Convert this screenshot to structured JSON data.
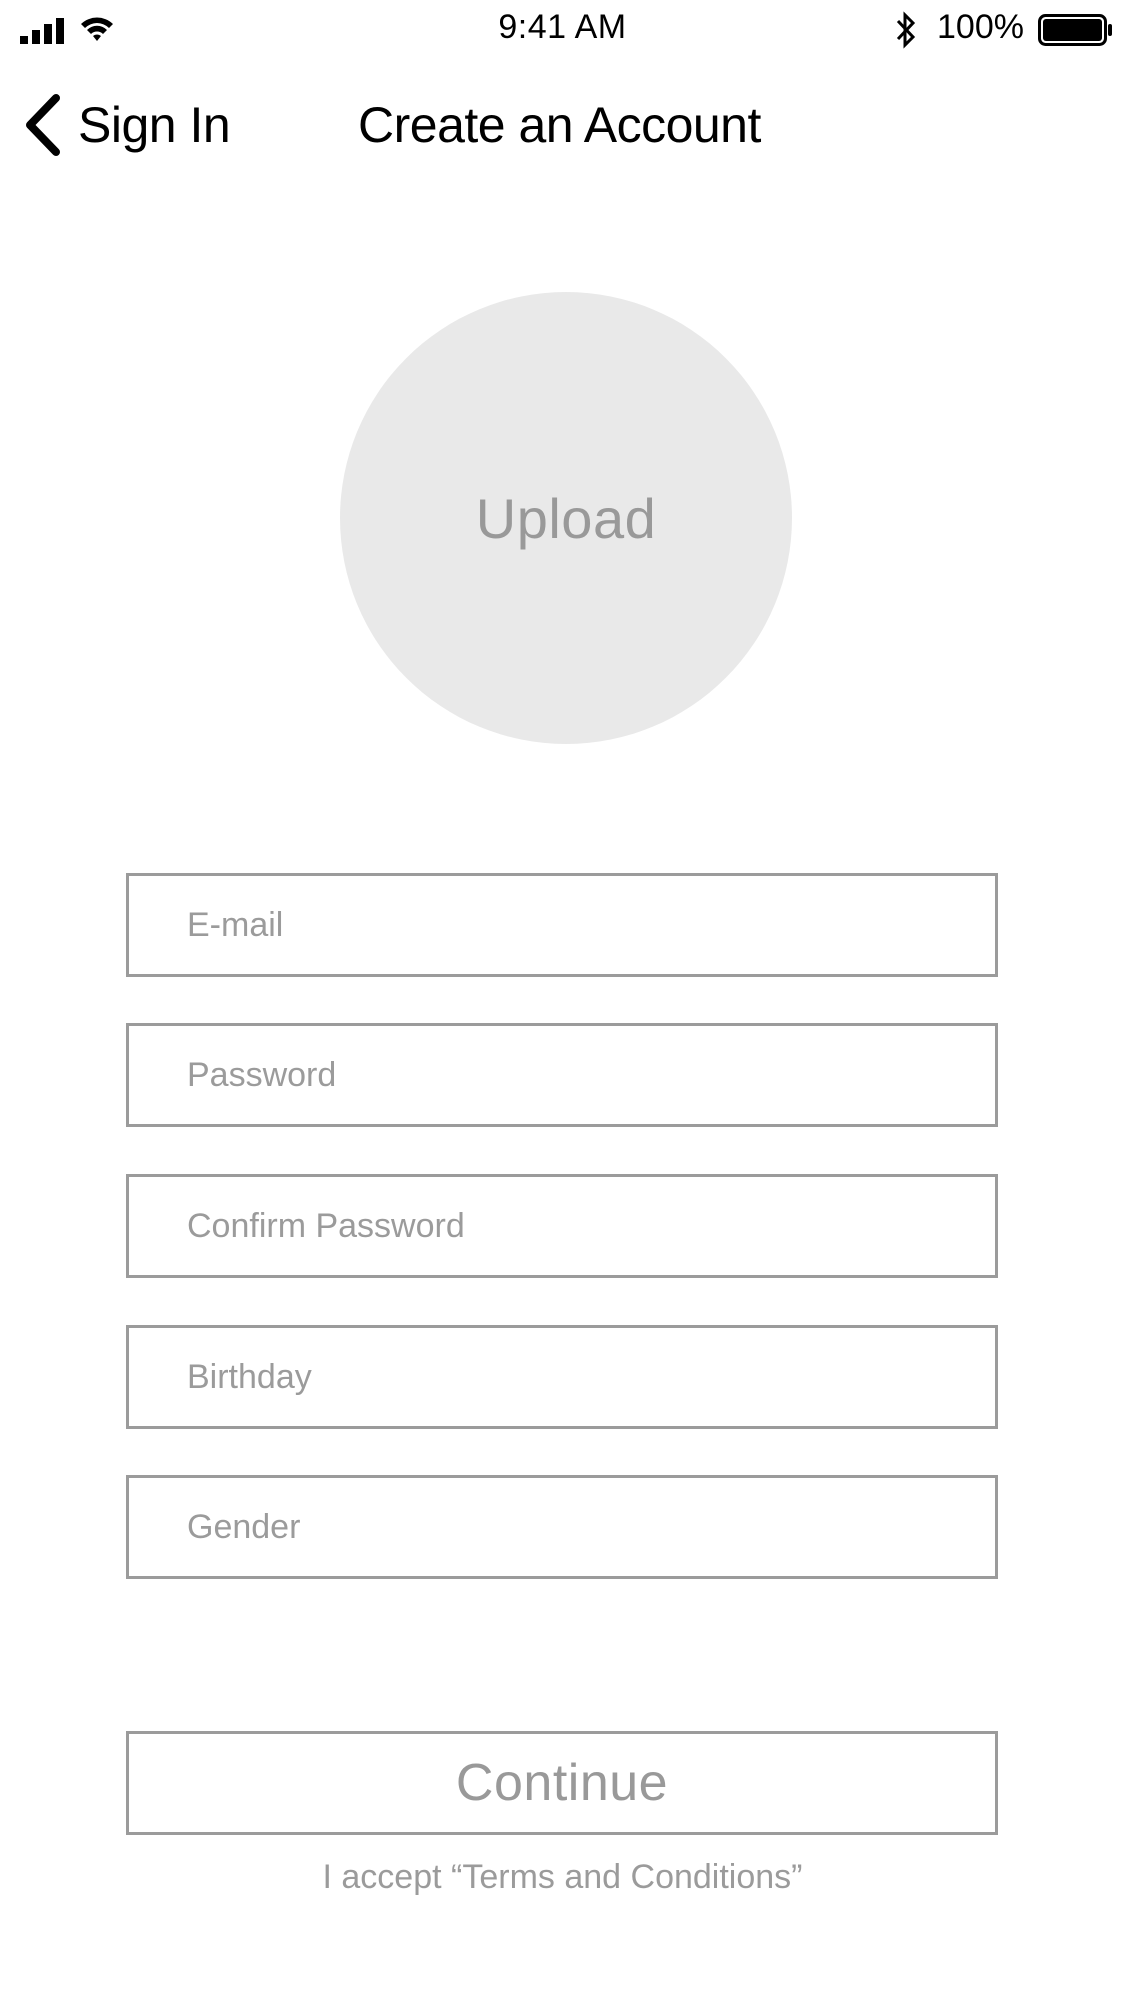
{
  "status_bar": {
    "time": "9:41 AM",
    "battery_percent": "100%",
    "icons": [
      "signal-icon",
      "wifi-icon",
      "bluetooth-icon",
      "battery-icon"
    ],
    "battery_level": 1.0
  },
  "nav": {
    "back_label": "Sign In",
    "back_icon": "chevron-left-icon",
    "title": "Create an Account"
  },
  "avatar": {
    "upload_label": "Upload",
    "background_color": "#e9e9e9"
  },
  "form": {
    "email_placeholder": "E-mail",
    "password_placeholder": "Password",
    "confirm_password_placeholder": "Confirm Password",
    "birthday_placeholder": "Birthday",
    "gender_placeholder": "Gender"
  },
  "actions": {
    "continue_label": "Continue",
    "terms_text": "I accept “Terms and Conditions”"
  },
  "colors": {
    "border": "#9b9b9b",
    "muted_text": "#999999"
  }
}
